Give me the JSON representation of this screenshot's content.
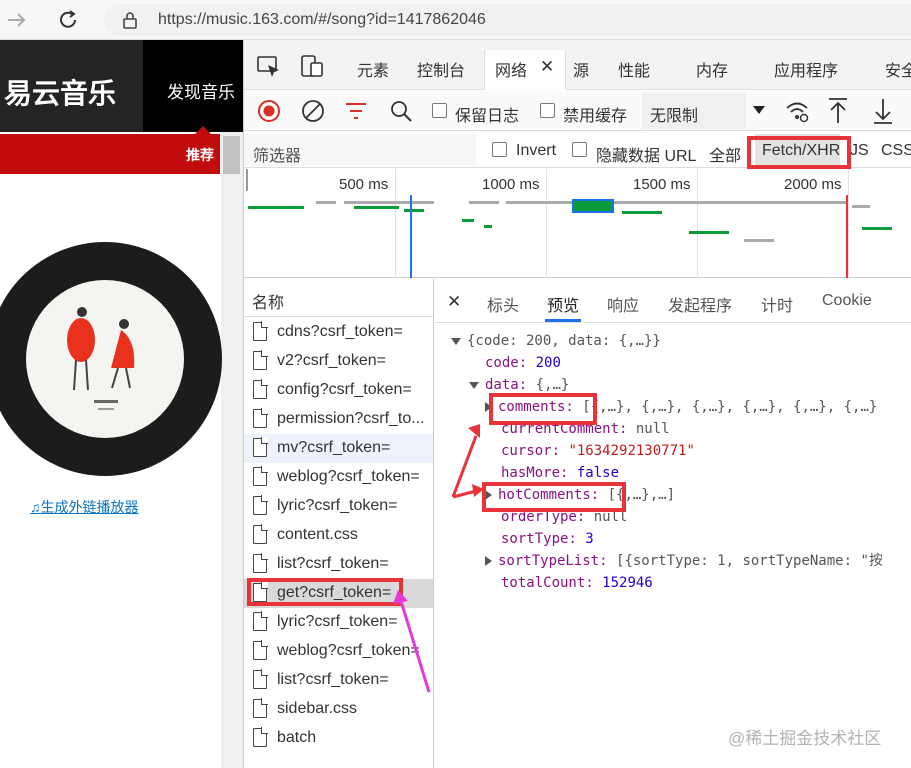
{
  "browser": {
    "url": "https://music.163.com/#/song?id=1417862046"
  },
  "site": {
    "logo": "易云音乐",
    "nav_item": "发现音乐",
    "subnav_item": "推荐",
    "external_link": "生成外链播放器"
  },
  "devtools": {
    "tabs": [
      "元素",
      "控制台",
      "网络",
      "源",
      "性能",
      "内存",
      "应用程序",
      "安全"
    ],
    "toolbar": {
      "preserve_log": "保留日志",
      "disable_cache": "禁用缓存",
      "throttle": "无限制"
    },
    "filter": {
      "placeholder": "筛选器",
      "invert": "Invert",
      "hide_data_url": "隐藏数据 URL",
      "all": "全部",
      "fetch_xhr": "Fetch/XHR",
      "js": "JS",
      "css": "CSS"
    },
    "timeline_ticks": [
      "500 ms",
      "1000 ms",
      "1500 ms",
      "2000 ms"
    ],
    "names_header": "名称",
    "requests": [
      "cdns?csrf_token=",
      "v2?csrf_token=",
      "config?csrf_token=",
      "permission?csrf_to...",
      "mv?csrf_token=",
      "weblog?csrf_token=",
      "lyric?csrf_token=",
      "content.css",
      "list?csrf_token=",
      "get?csrf_token=",
      "lyric?csrf_token=",
      "weblog?csrf_token=",
      "list?csrf_token=",
      "sidebar.css",
      "batch"
    ],
    "detail_tabs": [
      "标头",
      "预览",
      "响应",
      "发起程序",
      "计时",
      "Cookie"
    ],
    "preview": {
      "root": "{code: 200, data: {,…}}",
      "code_key": "code:",
      "code_val": "200",
      "data_key": "data:",
      "data_val": "{,…}",
      "comments_key": "comments:",
      "comments_val": "[{,…}, {,…}, {,…}, {,…}, {,…}, {,…}",
      "currentComment_key": "currentComment:",
      "currentComment_val": "null",
      "cursor_key": "cursor:",
      "cursor_val": "\"1634292130771\"",
      "hasMore_key": "hasMore:",
      "hasMore_val": "false",
      "hotComments_key": "hotComments:",
      "hotComments_val": "[{,…},…]",
      "orderType_key": "orderType:",
      "orderType_val": "null",
      "sortType_key": "sortType:",
      "sortType_val": "3",
      "sortTypeList_key": "sortTypeList:",
      "sortTypeList_val": "[{sortType: 1, sortTypeName: \"按",
      "totalCount_key": "totalCount:",
      "totalCount_val": "152946"
    }
  },
  "watermark": "@稀土掘金技术社区",
  "colors": {
    "highlight_red": "#e8333b",
    "arrow_magenta": "#e43bd8",
    "netease_red": "#c20c0c"
  }
}
